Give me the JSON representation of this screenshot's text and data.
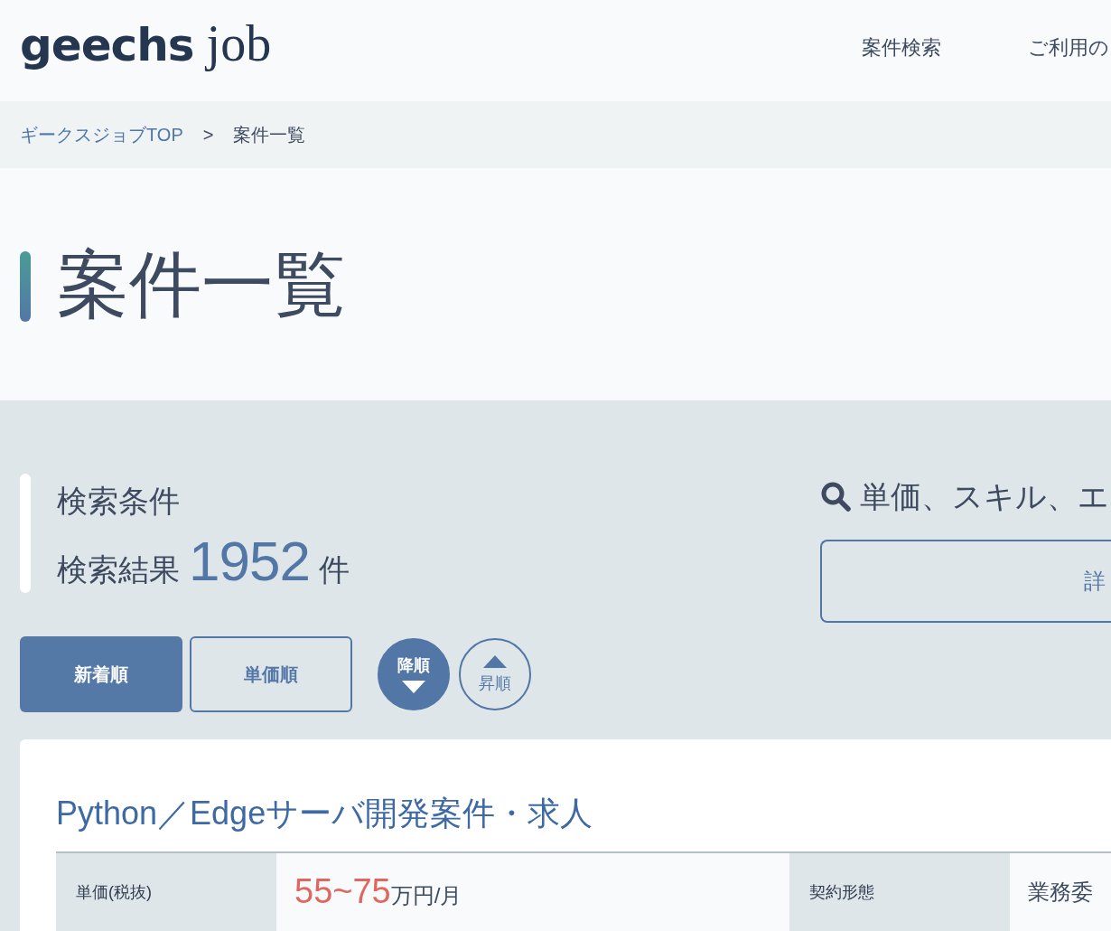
{
  "header": {
    "logo": {
      "primary": "geechs",
      "secondary": "job"
    },
    "nav": [
      "案件検索",
      "ご利用の"
    ]
  },
  "breadcrumb": {
    "items": [
      {
        "label": "ギークスジョブTOP",
        "kind": "link"
      },
      {
        "label": "案件一覧",
        "kind": "current"
      }
    ],
    "separator": ">"
  },
  "page_title": "案件一覧",
  "search_summary": {
    "heading": "検索条件",
    "result_label": "検索結果",
    "result_count": "1952",
    "result_unit": "件"
  },
  "search_panel": {
    "heading": "単価、スキル、エ",
    "detail_button": "詳"
  },
  "sort_keys": [
    {
      "label": "新着順",
      "selected": true
    },
    {
      "label": "単価順",
      "selected": false
    }
  ],
  "sort_order": [
    {
      "label": "降順",
      "kind": "desc",
      "selected": true
    },
    {
      "label": "昇順",
      "kind": "asc",
      "selected": false
    }
  ],
  "jobs": [
    {
      "title": "Python／Edgeサーバ開発案件・求人",
      "specs": [
        {
          "kind": "price",
          "label": "単価(税抜)",
          "amount": "55~75",
          "unit": "万円/月"
        },
        {
          "kind": "text",
          "label": "契約形態",
          "value": "業務委"
        }
      ]
    }
  ]
}
